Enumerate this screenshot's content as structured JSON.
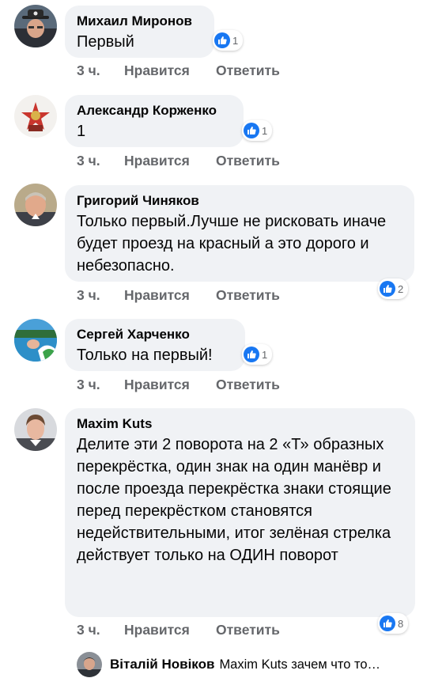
{
  "colors": {
    "bubble_bg": "#f0f2f5",
    "action_text": "#65676b",
    "like_blue": "#1877f2"
  },
  "comments": [
    {
      "author": "Михаил Миронов",
      "text": "Первый",
      "time": "3 ч.",
      "like_label": "Нравится",
      "reply_label": "Ответить",
      "reaction_icon": "thumbs-up-icon",
      "reactions": "1"
    },
    {
      "author": "Александр Корженко",
      "text": "1",
      "time": "3 ч.",
      "like_label": "Нравится",
      "reply_label": "Ответить",
      "reaction_icon": "thumbs-up-icon",
      "reactions": "1"
    },
    {
      "author": "Григорий Чиняков",
      "text": "Только первый.Лучше не рисковать иначе будет проезд на красный а это дорого и небезопасно.",
      "time": "3 ч.",
      "like_label": "Нравится",
      "reply_label": "Ответить",
      "reaction_icon": "thumbs-up-icon",
      "reactions": "2"
    },
    {
      "author": "Сергей Харченко",
      "text": "Только на первый!",
      "time": "3 ч.",
      "like_label": "Нравится",
      "reply_label": "Ответить",
      "reaction_icon": "thumbs-up-icon",
      "reactions": "1"
    },
    {
      "author": "Maxim Kuts",
      "text": "Делите эти 2 поворота на 2 «Т» образных перекрёстка, один знак на один манёвр и после проезда перекрёстка знаки стоящие перед перекрёстком становятся недействительными, итог зелёная стрелка действует только на ОДИН поворот",
      "time": "3 ч.",
      "like_label": "Нравится",
      "reply_label": "Ответить",
      "reaction_icon": "thumbs-up-icon",
      "reactions": "8"
    }
  ],
  "reply_preview": {
    "author": "Віталій Новіков",
    "text": "Maxim Kuts зачем что то…"
  }
}
